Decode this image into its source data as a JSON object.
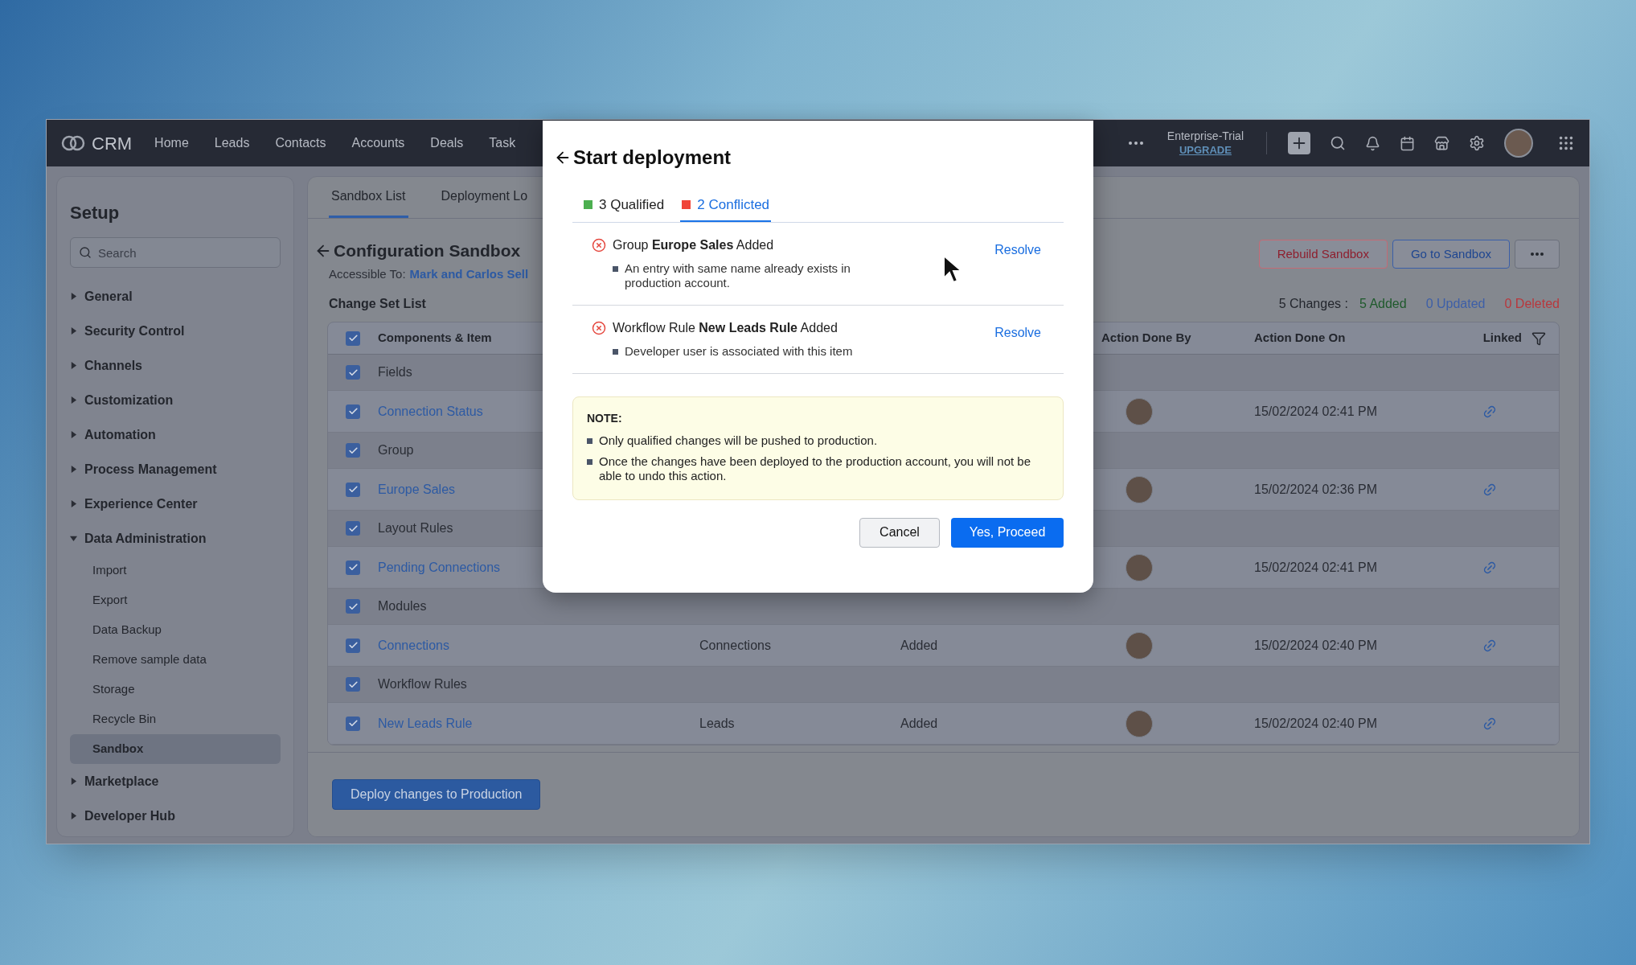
{
  "topbar": {
    "logo": "CRM",
    "nav": [
      "Home",
      "Leads",
      "Contacts",
      "Accounts",
      "Deals",
      "Task"
    ],
    "plan": "Enterprise-Trial",
    "upgrade": "UPGRADE"
  },
  "sidebar": {
    "title": "Setup",
    "search": {
      "placeholder": "Search"
    },
    "items": [
      {
        "label": "General",
        "expanded": false
      },
      {
        "label": "Security Control",
        "expanded": false
      },
      {
        "label": "Channels",
        "expanded": false
      },
      {
        "label": "Customization",
        "expanded": false
      },
      {
        "label": "Automation",
        "expanded": false
      },
      {
        "label": "Process Management",
        "expanded": false
      },
      {
        "label": "Experience Center",
        "expanded": false
      },
      {
        "label": "Data Administration",
        "expanded": true,
        "children": [
          {
            "label": "Import",
            "selected": false
          },
          {
            "label": "Export",
            "selected": false
          },
          {
            "label": "Data Backup",
            "selected": false
          },
          {
            "label": "Remove sample data",
            "selected": false
          },
          {
            "label": "Storage",
            "selected": false
          },
          {
            "label": "Recycle Bin",
            "selected": false
          },
          {
            "label": "Sandbox",
            "selected": true
          }
        ]
      },
      {
        "label": "Marketplace",
        "expanded": false
      },
      {
        "label": "Developer Hub",
        "expanded": false
      }
    ]
  },
  "tabs": [
    {
      "label": "Sandbox List",
      "selected": true
    },
    {
      "label": "Deployment Lo",
      "selected": false
    }
  ],
  "header": {
    "title": "Configuration Sandbox",
    "accessible_label": "Accessible To:",
    "accessible_value": "Mark and Carlos Sell",
    "buttons": [
      {
        "label": "Rebuild Sandbox",
        "kind": "danger"
      },
      {
        "label": "Go to Sandbox",
        "kind": "primary"
      }
    ]
  },
  "change_set": {
    "title": "Change Set List",
    "summary": "5 Changes :",
    "counts": [
      {
        "text": "5 Added",
        "color": "#1f5a2c"
      },
      {
        "text": "0 Updated",
        "color": "#3d5fa8"
      },
      {
        "text": "0 Deleted",
        "color": "#b8383d"
      }
    ]
  },
  "table": {
    "all_checked": true,
    "columns": [
      "Components & Item",
      "Action Done By",
      "Action Done On",
      "Linked"
    ],
    "rows": [
      {
        "kind": "group",
        "label": "Fields",
        "checked": true
      },
      {
        "kind": "item",
        "label": "Connection Status",
        "checked": true,
        "date": "15/02/2024 02:41 PM"
      },
      {
        "kind": "group",
        "label": "Group",
        "checked": true
      },
      {
        "kind": "item",
        "label": "Europe Sales",
        "checked": true,
        "date": "15/02/2024 02:36 PM"
      },
      {
        "kind": "group",
        "label": "Layout Rules",
        "checked": true
      },
      {
        "kind": "item",
        "label": "Pending Connections",
        "checked": true,
        "date": "15/02/2024 02:41 PM"
      },
      {
        "kind": "group",
        "label": "Modules",
        "checked": true
      },
      {
        "kind": "item",
        "label": "Connections",
        "checked": true,
        "type": "Connections",
        "status": "Added",
        "date": "15/02/2024 02:40 PM"
      },
      {
        "kind": "group",
        "label": "Workflow Rules",
        "checked": true
      },
      {
        "kind": "item",
        "label": "New Leads Rule",
        "checked": true,
        "type": "Leads",
        "status": "Added",
        "date": "15/02/2024 02:40 PM"
      }
    ]
  },
  "footer": {
    "button": "Deploy changes to Production"
  },
  "modal": {
    "title": "Start deployment",
    "tabs": [
      {
        "label": "3 Qualified",
        "color": "#4caf50",
        "selected": false
      },
      {
        "label": "2 Conflicted",
        "color": "#f04438",
        "selected": true
      }
    ],
    "conflicts": [
      {
        "title": "Group **Europe Sales** Added",
        "reason": "An entry with same name already exists in production account.",
        "action": "Resolve"
      },
      {
        "title": "Workflow Rule **New Leads Rule** Added",
        "reason": "Developer user is associated with this item",
        "action": "Resolve"
      }
    ],
    "note": {
      "title": "NOTE:",
      "items": [
        "Only qualified changes will be pushed to production.",
        "Once the changes have been deployed to the production account, you will not be able to undo this action."
      ]
    },
    "cancel": "Cancel",
    "proceed": "Yes, Proceed"
  }
}
